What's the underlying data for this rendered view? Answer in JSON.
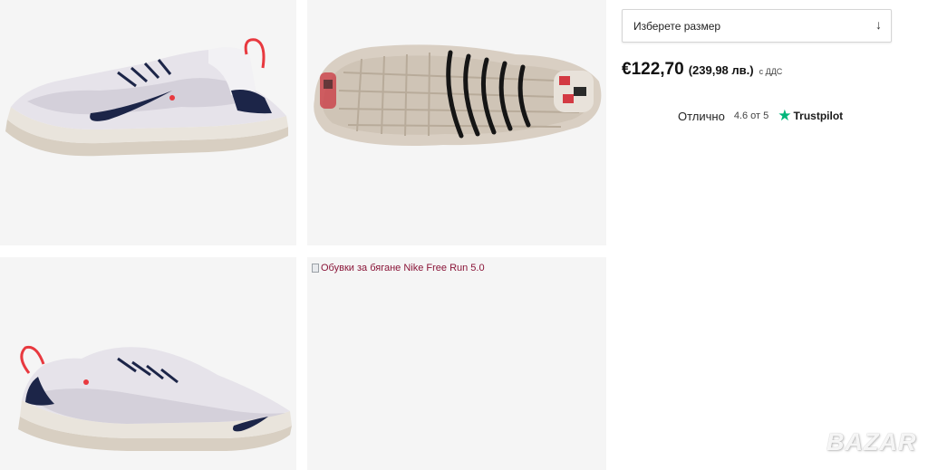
{
  "gallery": {
    "images": [
      {
        "alt": "shoe-side-view"
      },
      {
        "alt": "shoe-sole-view"
      },
      {
        "alt": "shoe-inner-side-view"
      },
      {
        "alt": "Обувки за бягане Nike Free Run 5.0"
      }
    ],
    "broken_image_alt": "Обувки за бягане Nike Free Run 5.0"
  },
  "product": {
    "size_select": {
      "placeholder": "Изберете размер",
      "arrow": "↓"
    },
    "price": {
      "eur": "€122,70",
      "bgn": "(239,98 лв.)",
      "vat_note": "с ДДС"
    }
  },
  "trustpilot": {
    "rating_word": "Отлично",
    "score": "4.6 от 5",
    "star": "★",
    "brand": "Trustpilot"
  },
  "watermark": {
    "text": "BAZAR"
  },
  "colors": {
    "price": "#111111",
    "trustpilot_green": "#00b67a",
    "gallery_bg": "#f5f5f5",
    "broken_alt_text": "#8a1538"
  }
}
